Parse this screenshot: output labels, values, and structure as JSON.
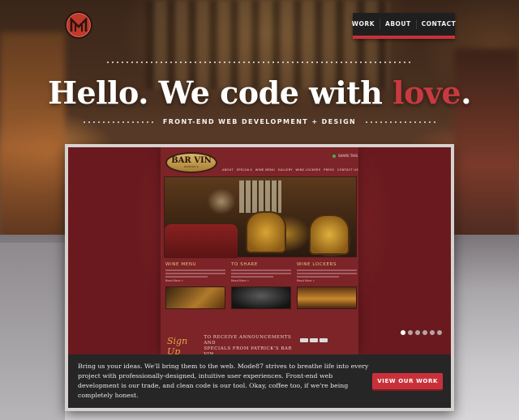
{
  "logo": {
    "icon": "m87-monogram-icon"
  },
  "nav": {
    "items": [
      {
        "label": "WORK"
      },
      {
        "label": "ABOUT"
      },
      {
        "label": "CONTACT"
      }
    ]
  },
  "hero": {
    "headline_main": "Hello. We code with ",
    "headline_accent": "love",
    "headline_end": ".",
    "subheadline": "FRONT-END WEB DEVELOPMENT + DESIGN"
  },
  "colors": {
    "accent": "#c9313a",
    "caption_bg": "#262626",
    "frame": "#d7d2d0"
  },
  "showcase": {
    "site": {
      "logo_text": "BAR VIN",
      "logo_subtext": "PATRICK'S",
      "share_label": "SHARE THIS",
      "nav": [
        "ABOUT",
        "SPECIALS",
        "WINE MENU",
        "GALLERY",
        "WINE LOCKERS",
        "PRESS",
        "CONTACT US"
      ],
      "columns": [
        {
          "title": "WINE MENU",
          "more": "Read More »"
        },
        {
          "title": "TO SHARE",
          "more": "Read More »"
        },
        {
          "title": "WINE LOCKERS",
          "more": "Read More »"
        }
      ],
      "signup_script": "Sign Up",
      "signup_text_1": "TO RECEIVE ANNOUNCEMENTS AND",
      "signup_text_2": "SPECIALS FROM PATRICK'S BAR VIN"
    },
    "slider_dot_count": 6,
    "caption": "Bring us your ideas. We'll bring them to the web. Mode87 strives to breathe life into every project with professionally-designed, intuitive user experiences. Front-end web development is our trade, and clean code is our tool. Okay, coffee too, if we're being completely honest.",
    "button_label": "VIEW OUR WORK"
  }
}
